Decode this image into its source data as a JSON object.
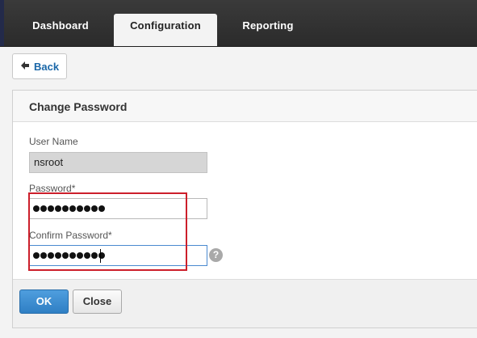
{
  "nav": {
    "tabs": [
      {
        "label": "Dashboard",
        "active": false
      },
      {
        "label": "Configuration",
        "active": true
      },
      {
        "label": "Reporting",
        "active": false
      }
    ]
  },
  "back": {
    "label": "Back",
    "icon": "back-arrow-icon"
  },
  "form": {
    "title": "Change Password",
    "username": {
      "label": "User Name",
      "value": "nsroot"
    },
    "password": {
      "label": "Password*",
      "masked_length": 10
    },
    "confirm_password": {
      "label": "Confirm Password*",
      "masked_length": 10
    },
    "help_icon": "?"
  },
  "actions": {
    "ok_label": "OK",
    "close_label": "Close"
  },
  "colors": {
    "accent": "#2f7fc4",
    "highlight": "#cc1f2b",
    "topbar": "#2b2b2b",
    "link": "#1a67a8"
  }
}
